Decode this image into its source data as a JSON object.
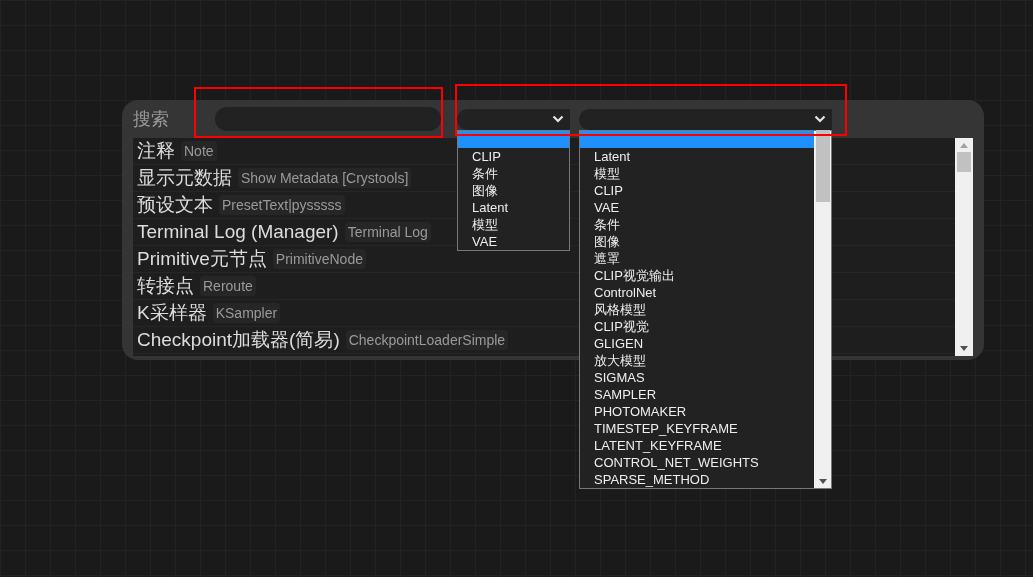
{
  "search": {
    "label": "搜索",
    "highlighted": true
  },
  "type_filters": {
    "highlighted": true,
    "selects": [
      {
        "expanded": true,
        "options": [
          {
            "selected": true
          },
          {
            "label": "CLIP",
            "selected": false
          },
          {
            "label": "条件",
            "selected": false
          },
          {
            "label": "图像",
            "selected": false
          },
          {
            "label": "Latent",
            "selected": false
          },
          {
            "label": "模型",
            "selected": false
          },
          {
            "label": "VAE",
            "selected": false
          }
        ]
      },
      {
        "expanded": true,
        "options": [
          {
            "selected": true
          },
          {
            "label": "Latent",
            "selected": false
          },
          {
            "label": "模型",
            "selected": false
          },
          {
            "label": "CLIP",
            "selected": false
          },
          {
            "label": "VAE",
            "selected": false
          },
          {
            "label": "条件",
            "selected": false
          },
          {
            "label": "图像",
            "selected": false
          },
          {
            "label": "遮罩",
            "selected": false
          },
          {
            "label": "CLIP视觉输出",
            "selected": false
          },
          {
            "label": "ControlNet",
            "selected": false
          },
          {
            "label": "风格模型",
            "selected": false
          },
          {
            "label": "CLIP视觉",
            "selected": false
          },
          {
            "label": "GLIGEN",
            "selected": false
          },
          {
            "label": "放大模型",
            "selected": false
          },
          {
            "label": "SIGMAS",
            "selected": false
          },
          {
            "label": "SAMPLER",
            "selected": false
          },
          {
            "label": "PHOTOMAKER",
            "selected": false
          },
          {
            "label": "TIMESTEP_KEYFRAME",
            "selected": false
          },
          {
            "label": "LATENT_KEYFRAME",
            "selected": false
          },
          {
            "label": "CONTROL_NET_WEIGHTS",
            "selected": false
          },
          {
            "label": "SPARSE_METHOD",
            "selected": false
          }
        ]
      }
    ]
  },
  "results": [
    {
      "title": "注释",
      "node": "Note"
    },
    {
      "title": "显示元数据",
      "node": "Show Metadata [Crystools]"
    },
    {
      "title": "预设文本",
      "node": "PresetText|pysssss"
    },
    {
      "title": "Terminal Log (Manager)",
      "node": "Terminal Log"
    },
    {
      "title": "Primitive元节点",
      "node": "PrimitiveNode"
    },
    {
      "title": "转接点",
      "node": "Reroute"
    },
    {
      "title": "K采样器",
      "node": "KSampler"
    },
    {
      "title": "Checkpoint加载器(简易)",
      "node": "CheckpointLoaderSimple"
    }
  ]
}
